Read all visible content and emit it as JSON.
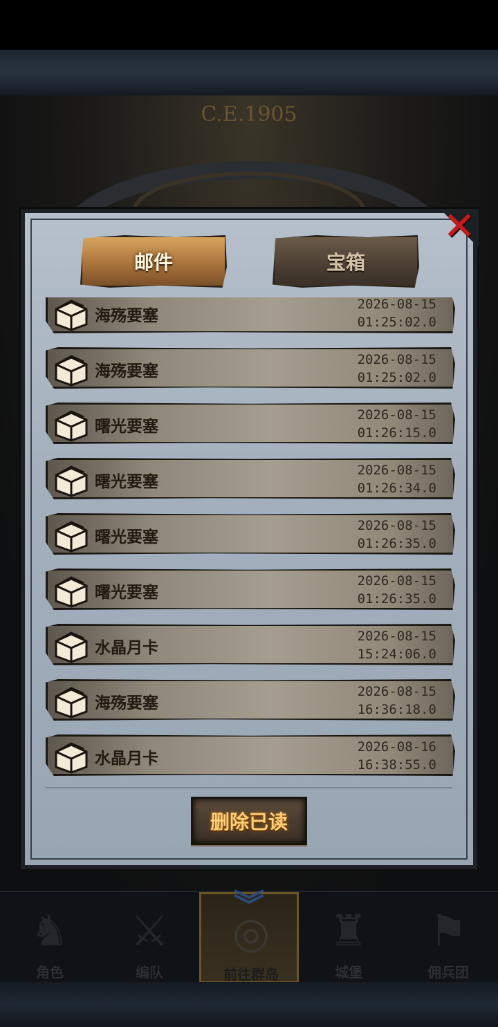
{
  "background": {
    "year_label": "C.E.1905"
  },
  "tabs": [
    {
      "label": "邮件",
      "active": true
    },
    {
      "label": "宝箱",
      "active": false
    }
  ],
  "mails": [
    {
      "sender": "海殇要塞",
      "date": "2026-08-15",
      "time": "01:25:02.0"
    },
    {
      "sender": "海殇要塞",
      "date": "2026-08-15",
      "time": "01:25:02.0"
    },
    {
      "sender": "曙光要塞",
      "date": "2026-08-15",
      "time": "01:26:15.0"
    },
    {
      "sender": "曙光要塞",
      "date": "2026-08-15",
      "time": "01:26:34.0"
    },
    {
      "sender": "曙光要塞",
      "date": "2026-08-15",
      "time": "01:26:35.0"
    },
    {
      "sender": "曙光要塞",
      "date": "2026-08-15",
      "time": "01:26:35.0"
    },
    {
      "sender": "水晶月卡",
      "date": "2026-08-15",
      "time": "15:24:06.0"
    },
    {
      "sender": "海殇要塞",
      "date": "2026-08-15",
      "time": "16:36:18.0"
    },
    {
      "sender": "水晶月卡",
      "date": "2026-08-16",
      "time": "16:38:55.0"
    }
  ],
  "delete_read_label": "删除已读",
  "nav": [
    {
      "label": "角色",
      "icon": "character-icon"
    },
    {
      "label": "编队",
      "icon": "formation-icon"
    },
    {
      "label": "前往群岛",
      "icon": "island-compass-icon",
      "active": true
    },
    {
      "label": "城堡",
      "icon": "castle-icon"
    },
    {
      "label": "佣兵团",
      "icon": "mercenary-icon"
    }
  ],
  "colors": {
    "close_red": "#c8191b",
    "tab_active": "#b07a40",
    "button_text": "#ffce78"
  }
}
